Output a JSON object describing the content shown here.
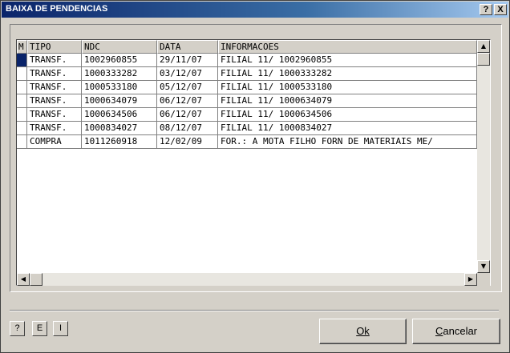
{
  "window": {
    "title": "BAIXA DE PENDENCIAS",
    "help_button": "?",
    "close_button": "X"
  },
  "grid": {
    "columns": [
      "M",
      "TIPO",
      "NDC",
      "DATA",
      "INFORMACOES"
    ],
    "rows": [
      {
        "m": "",
        "tipo": "TRANSF.",
        "ndc": "1002960855",
        "data": "29/11/07",
        "info": "FILIAL 11/ 1002960855",
        "selected": true
      },
      {
        "m": "",
        "tipo": "TRANSF.",
        "ndc": "1000333282",
        "data": "03/12/07",
        "info": "FILIAL 11/ 1000333282",
        "selected": false
      },
      {
        "m": "",
        "tipo": "TRANSF.",
        "ndc": "1000533180",
        "data": "05/12/07",
        "info": "FILIAL 11/ 1000533180",
        "selected": false
      },
      {
        "m": "",
        "tipo": "TRANSF.",
        "ndc": "1000634079",
        "data": "06/12/07",
        "info": "FILIAL 11/ 1000634079",
        "selected": false
      },
      {
        "m": "",
        "tipo": "TRANSF.",
        "ndc": "1000634506",
        "data": "06/12/07",
        "info": "FILIAL 11/ 1000634506",
        "selected": false
      },
      {
        "m": "",
        "tipo": "TRANSF.",
        "ndc": "1000834027",
        "data": "08/12/07",
        "info": "FILIAL 11/ 1000834027",
        "selected": false
      },
      {
        "m": "",
        "tipo": "COMPRA",
        "ndc": "1011260918",
        "data": "12/02/09",
        "info": "FOR.: A MOTA FILHO FORN DE MATERIAIS ME/",
        "selected": false
      }
    ]
  },
  "scroll": {
    "up_arrow": "▲",
    "down_arrow": "▼",
    "left_arrow": "◀",
    "right_arrow": "▶"
  },
  "toolbar": {
    "help_label": "?",
    "e_label": "E",
    "i_label": "I"
  },
  "buttons": {
    "ok_label": "Ok",
    "cancel_label": "Cancelar"
  },
  "colors": {
    "selection": "#0a246a",
    "face": "#d4d0c8"
  }
}
